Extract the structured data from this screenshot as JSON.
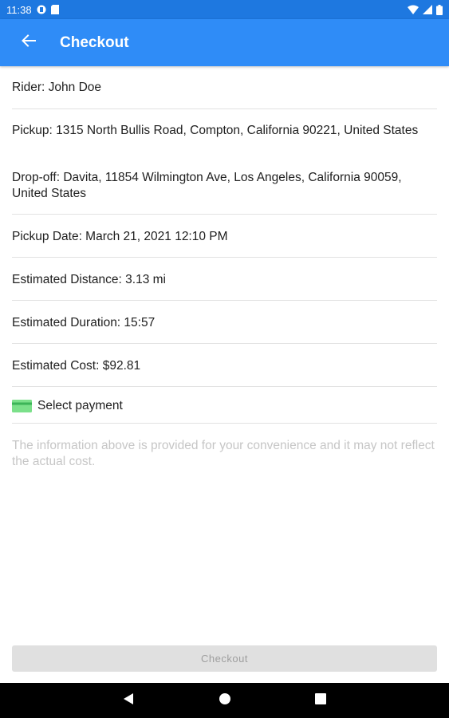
{
  "status_bar": {
    "time": "11:38",
    "icons": [
      "notification-icon",
      "sim-card-icon",
      "wifi-icon",
      "signal-icon",
      "battery-icon"
    ]
  },
  "app_bar": {
    "title": "Checkout",
    "back_icon": "arrow-left-icon",
    "background_color": "#2f8cf7"
  },
  "trip": {
    "rider": "Rider: John Doe",
    "pickup": "Pickup: 1315 North Bullis Road, Compton, California 90221, United States",
    "dropoff": "Drop-off: Davita, 11854 Wilmington Ave, Los Angeles, California 90059, United States",
    "pickup_date": "Pickup Date: March 21, 2021 12:10 PM",
    "distance": "Estimated Distance: 3.13 mi",
    "duration": "Estimated Duration: 15:57",
    "cost": "Estimated Cost: $92.81"
  },
  "payment": {
    "label": "Select payment",
    "icon": "credit-card-icon",
    "icon_color": "#7be08a"
  },
  "disclaimer": "The information above is provided for your convenience and it may not reflect the actual cost.",
  "checkout_button": {
    "label": "Checkout",
    "enabled": false
  },
  "nav_bar": {
    "icons": [
      "back-triangle-icon",
      "home-circle-icon",
      "recents-square-icon"
    ]
  }
}
